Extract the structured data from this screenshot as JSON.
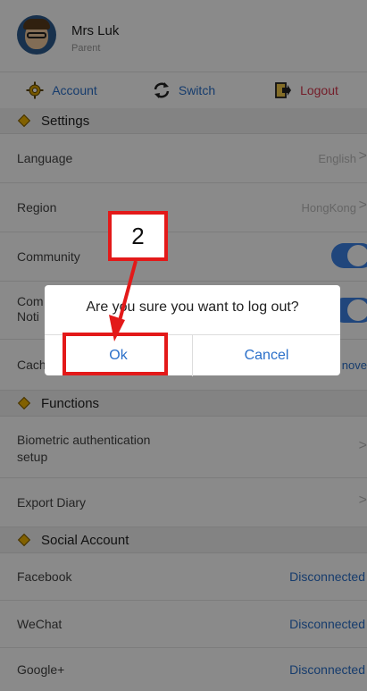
{
  "profile": {
    "name": "Mrs Luk",
    "role": "Parent"
  },
  "actions": {
    "account": "Account",
    "switch": "Switch",
    "logout": "Logout"
  },
  "settings": {
    "title": "Settings",
    "language": {
      "label": "Language",
      "value": "English"
    },
    "region": {
      "label": "Region",
      "value": "HongKong"
    },
    "community": {
      "label": "Community"
    },
    "community_notification": {
      "label_line1": "Com",
      "label_line2": "Noti"
    },
    "cache": {
      "label": "Cach",
      "action": "nove"
    }
  },
  "functions": {
    "title": "Functions",
    "biometric": {
      "label_line1": "Biometric authentication",
      "label_line2": "setup"
    },
    "export": {
      "label": "Export Diary"
    }
  },
  "social": {
    "title": "Social Account",
    "items": [
      {
        "label": "Facebook",
        "status": "Disconnected"
      },
      {
        "label": "WeChat",
        "status": "Disconnected"
      },
      {
        "label": "Google+",
        "status": "Disconnected"
      }
    ]
  },
  "dialog": {
    "message": "Are you sure you want to log out?",
    "ok": "Ok",
    "cancel": "Cancel"
  },
  "annotation": {
    "step": "2",
    "color": "#e31919"
  },
  "colors": {
    "accent": "#2a6fc9",
    "logout": "#d6374d",
    "diamond": "#f0b400",
    "toggle": "#3b82e6"
  }
}
